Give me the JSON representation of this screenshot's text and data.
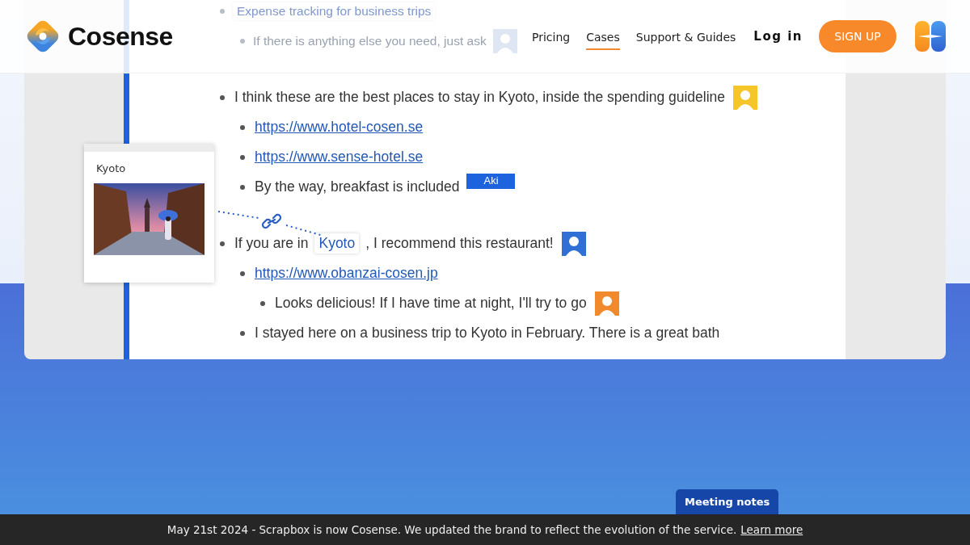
{
  "header": {
    "logo": "Cosense",
    "nav": [
      {
        "label": "Pricing",
        "selected": false
      },
      {
        "label": "Cases",
        "selected": true
      },
      {
        "label": "Support & Guides",
        "selected": false
      }
    ],
    "login": "Log in",
    "signup": "SIGN UP"
  },
  "document": {
    "items": [
      {
        "faded": true,
        "segments": [
          {
            "kind": "page-link",
            "text": "Expense tracking for business trips"
          }
        ],
        "children": [
          {
            "faded": true,
            "segments": [
              {
                "kind": "text",
                "text": "If there is anything else you need, just ask"
              }
            ],
            "avatar": {
              "color": "#dfe6f3"
            }
          }
        ]
      },
      {
        "faded": false,
        "segments": [
          {
            "kind": "text",
            "text": "I think these are the best places to stay in Kyoto, inside the spending guideline"
          }
        ],
        "avatar": {
          "color": "#f4c62a"
        },
        "children": [
          {
            "faded": false,
            "segments": [
              {
                "kind": "link",
                "text": "https://www.hotel-cosen.se"
              }
            ]
          },
          {
            "faded": false,
            "segments": [
              {
                "kind": "link",
                "text": "https://www.sense-hotel.se"
              }
            ]
          },
          {
            "faded": false,
            "segments": [
              {
                "kind": "text",
                "text": "By the way, breakfast is included"
              }
            ],
            "cursor": "Aki"
          }
        ]
      },
      {
        "faded": false,
        "segments": [
          {
            "kind": "text",
            "text": "If you are in"
          },
          {
            "kind": "page-link",
            "text": "Kyoto"
          },
          {
            "kind": "text",
            "text": ", I recommend this restaurant!"
          }
        ],
        "avatar": {
          "color": "#2f6fd6"
        },
        "children": [
          {
            "faded": false,
            "segments": [
              {
                "kind": "link",
                "text": "https://www.obanzai-cosen.jp"
              }
            ],
            "children": [
              {
                "faded": false,
                "segments": [
                  {
                    "kind": "text",
                    "text": "Looks delicious! If I have time at night, I'll try to go"
                  }
                ],
                "avatar": {
                  "color": "#f08a2c"
                }
              }
            ]
          },
          {
            "faded": false,
            "segments": [
              {
                "kind": "text",
                "text": "I stayed here on a business trip to Kyoto in February. There is a great bath"
              }
            ]
          }
        ]
      }
    ]
  },
  "page_card": {
    "title": "Kyoto",
    "kind": "picture"
  },
  "badge": "Meeting notes",
  "banner": {
    "text": "May 21st 2024 - Scrapbox is now Cosense. We updated the brand to reflect the evolution of the service.",
    "link": "Learn more"
  }
}
